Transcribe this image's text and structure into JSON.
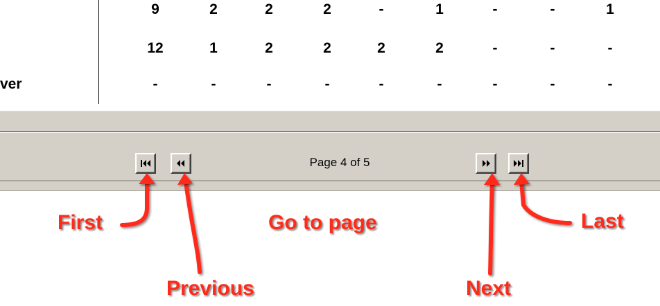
{
  "table": {
    "rows": [
      {
        "label": "",
        "cells": [
          "9",
          "2",
          "2",
          "2",
          "-",
          "1",
          "-",
          "-",
          "1"
        ]
      },
      {
        "label": "",
        "cells": [
          "12",
          "1",
          "2",
          "2",
          "2",
          "2",
          "-",
          "-",
          "-"
        ]
      },
      {
        "label": "ver",
        "cells": [
          "-",
          "-",
          "-",
          "-",
          "-",
          "-",
          "-",
          "-",
          "-"
        ]
      }
    ]
  },
  "pager": {
    "page_text": "Page 4 of 5",
    "first_icon": "first-page-icon",
    "previous_icon": "previous-page-icon",
    "next_icon": "next-page-icon",
    "last_icon": "last-page-icon"
  },
  "annotations": {
    "first": "First",
    "previous": "Previous",
    "go_to_page": "Go to page",
    "next": "Next",
    "last": "Last",
    "color": "#ff2b1a"
  }
}
